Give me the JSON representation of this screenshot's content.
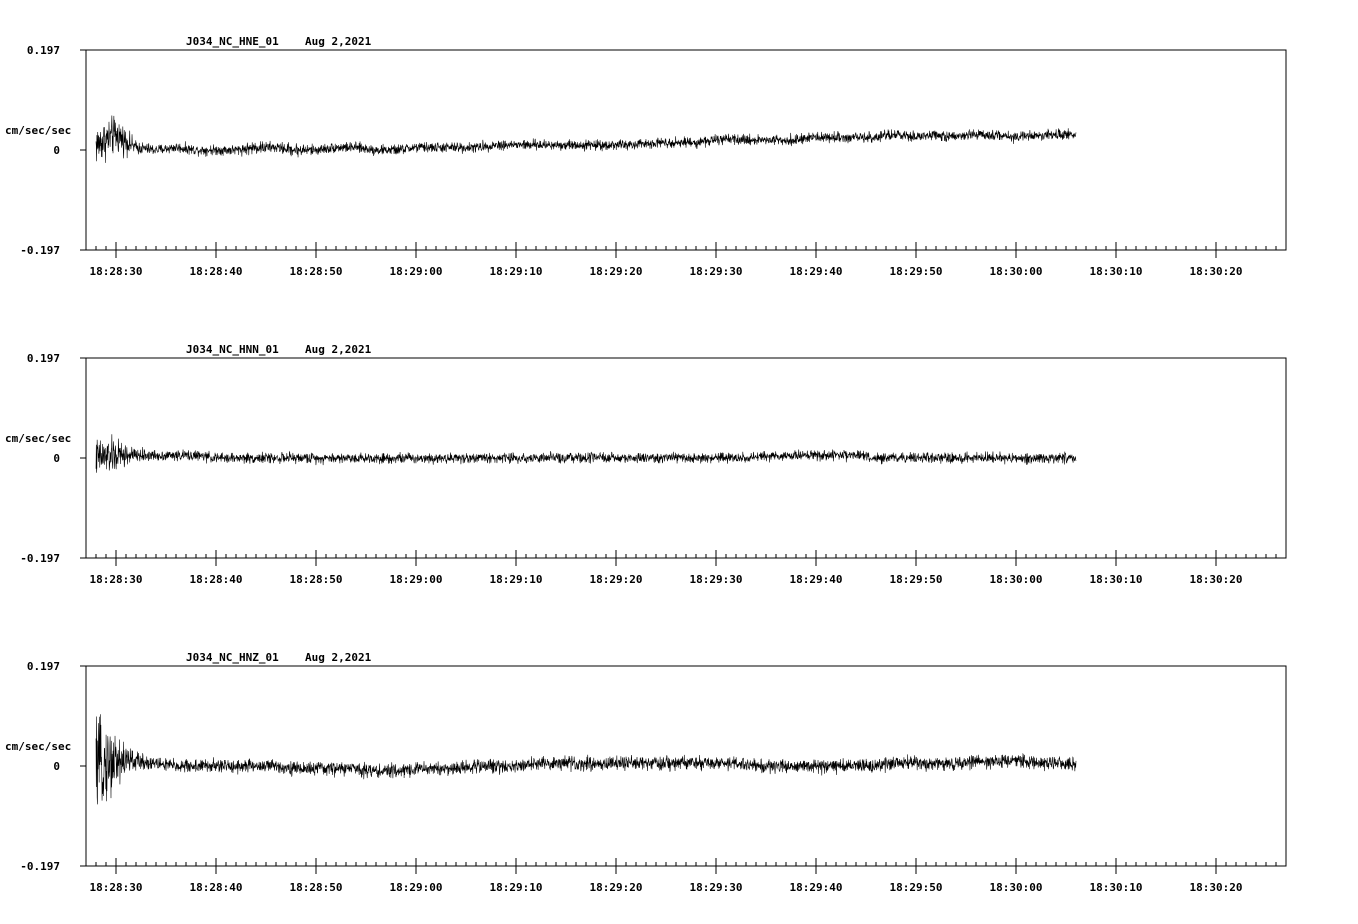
{
  "chart_data": [
    {
      "type": "line",
      "title": "J034_NC_HNE_01",
      "date": "Aug 2,2021",
      "ylabel": "cm/sec/sec",
      "ylim": [
        -0.197,
        0.197
      ],
      "ytick_labels": [
        "0.197",
        "0",
        "-0.197"
      ],
      "xtick_labels": [
        "18:28:30",
        "18:28:40",
        "18:28:50",
        "18:29:00",
        "18:29:10",
        "18:29:20",
        "18:29:30",
        "18:29:40",
        "18:29:50",
        "18:30:00",
        "18:30:10",
        "18:30:20"
      ],
      "x_range": [
        "18:28:27",
        "18:30:27"
      ],
      "series": [
        {
          "x_start": "18:28:28",
          "x_step_seconds": 2,
          "values": [
            0.01,
            0.03,
            0.005,
            0.0,
            0.005,
            0.0,
            0.0,
            0.0,
            0.005,
            0.005,
            0.0,
            0.0,
            0.005,
            0.005,
            0.0,
            0.0,
            0.005,
            0.005,
            0.005,
            0.005,
            0.01,
            0.01,
            0.01,
            0.01,
            0.01,
            0.01,
            0.01,
            0.01,
            0.015,
            0.015,
            0.015,
            0.02,
            0.02,
            0.02,
            0.02,
            0.02,
            0.025,
            0.025,
            0.025,
            0.025,
            0.03,
            0.025,
            0.03,
            0.025,
            0.03,
            0.03,
            0.025,
            0.03,
            0.03,
            0.03
          ],
          "envelope": [
            0.06,
            0.055,
            0.02,
            0.015,
            0.015,
            0.015,
            0.015,
            0.015,
            0.02,
            0.015,
            0.02,
            0.015,
            0.015,
            0.015,
            0.015,
            0.015,
            0.015,
            0.015,
            0.015,
            0.015,
            0.015,
            0.015,
            0.015,
            0.015,
            0.015,
            0.015,
            0.015,
            0.015,
            0.015,
            0.015,
            0.015,
            0.015,
            0.015,
            0.015,
            0.015,
            0.015,
            0.015,
            0.015,
            0.015,
            0.015,
            0.015,
            0.015,
            0.015,
            0.015,
            0.015,
            0.015,
            0.015,
            0.015,
            0.015,
            0.015
          ]
        }
      ]
    },
    {
      "type": "line",
      "title": "J034_NC_HNN_01",
      "date": "Aug 2,2021",
      "ylabel": "cm/sec/sec",
      "ylim": [
        -0.197,
        0.197
      ],
      "ytick_labels": [
        "0.197",
        "0",
        "-0.197"
      ],
      "xtick_labels": [
        "18:28:30",
        "18:28:40",
        "18:28:50",
        "18:29:00",
        "18:29:10",
        "18:29:20",
        "18:29:30",
        "18:29:40",
        "18:29:50",
        "18:30:00",
        "18:30:10",
        "18:30:20"
      ],
      "x_range": [
        "18:28:27",
        "18:30:27"
      ],
      "series": [
        {
          "x_start": "18:28:28",
          "x_step_seconds": 2,
          "values": [
            0.0,
            0.005,
            0.005,
            0.005,
            0.005,
            0.005,
            0.0,
            0.0,
            0.0,
            0.0,
            0.0,
            0.0,
            0.0,
            0.0,
            0.0,
            0.0,
            0.0,
            0.0,
            0.0,
            0.0,
            0.0,
            0.0,
            0.0,
            0.0,
            0.0,
            0.0,
            0.0,
            0.0,
            0.0,
            0.0,
            0.0,
            0.0,
            0.0,
            0.0,
            0.005,
            0.005,
            0.005,
            0.005,
            0.005,
            0.0,
            0.0,
            0.0,
            0.0,
            0.0,
            0.0,
            0.0,
            0.0,
            0.0,
            0.0,
            0.0
          ],
          "envelope": [
            0.055,
            0.05,
            0.02,
            0.015,
            0.015,
            0.015,
            0.015,
            0.015,
            0.015,
            0.015,
            0.015,
            0.015,
            0.015,
            0.015,
            0.015,
            0.015,
            0.015,
            0.015,
            0.015,
            0.015,
            0.015,
            0.015,
            0.015,
            0.015,
            0.015,
            0.015,
            0.015,
            0.015,
            0.015,
            0.015,
            0.015,
            0.015,
            0.015,
            0.015,
            0.015,
            0.015,
            0.015,
            0.015,
            0.015,
            0.015,
            0.015,
            0.015,
            0.015,
            0.015,
            0.015,
            0.015,
            0.015,
            0.015,
            0.015,
            0.015
          ]
        }
      ]
    },
    {
      "type": "line",
      "title": "J034_NC_HNZ_01",
      "date": "Aug 2,2021",
      "ylabel": "cm/sec/sec",
      "ylim": [
        -0.197,
        0.197
      ],
      "ytick_labels": [
        "0.197",
        "0",
        "-0.197"
      ],
      "xtick_labels": [
        "18:28:30",
        "18:28:40",
        "18:28:50",
        "18:29:00",
        "18:29:10",
        "18:29:20",
        "18:29:30",
        "18:29:40",
        "18:29:50",
        "18:30:00",
        "18:30:10",
        "18:30:20"
      ],
      "x_range": [
        "18:28:27",
        "18:30:27"
      ],
      "series": [
        {
          "x_start": "18:28:28",
          "x_step_seconds": 2,
          "values": [
            0.0,
            0.01,
            0.01,
            0.005,
            0.0,
            0.0,
            0.0,
            0.0,
            0.0,
            0.0,
            -0.005,
            -0.005,
            -0.005,
            -0.005,
            -0.01,
            -0.01,
            -0.005,
            -0.005,
            -0.005,
            0.0,
            0.0,
            0.0,
            0.005,
            0.005,
            0.005,
            0.005,
            0.005,
            0.005,
            0.005,
            0.005,
            0.005,
            0.005,
            0.005,
            0.0,
            0.0,
            0.0,
            0.0,
            0.0,
            0.0,
            0.0,
            0.005,
            0.005,
            0.005,
            0.005,
            0.01,
            0.01,
            0.01,
            0.005,
            0.005,
            0.005
          ],
          "envelope": [
            0.12,
            0.09,
            0.025,
            0.02,
            0.02,
            0.02,
            0.02,
            0.02,
            0.02,
            0.02,
            0.02,
            0.02,
            0.02,
            0.02,
            0.02,
            0.02,
            0.02,
            0.02,
            0.02,
            0.02,
            0.02,
            0.02,
            0.02,
            0.02,
            0.02,
            0.02,
            0.02,
            0.02,
            0.02,
            0.02,
            0.02,
            0.02,
            0.02,
            0.02,
            0.02,
            0.02,
            0.02,
            0.02,
            0.02,
            0.02,
            0.02,
            0.02,
            0.02,
            0.02,
            0.02,
            0.02,
            0.02,
            0.02,
            0.02,
            0.02
          ]
        }
      ]
    }
  ]
}
